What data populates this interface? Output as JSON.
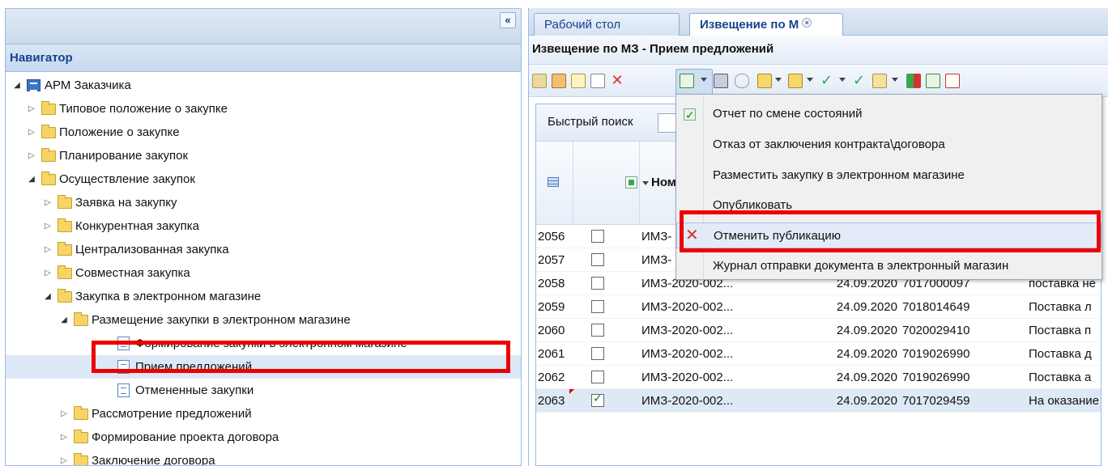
{
  "navigator": {
    "collapse_glyph": "«",
    "header": "Навигатор",
    "tree": [
      {
        "label": "АРМ Заказчика",
        "level": 0,
        "state": "expanded",
        "icon": "workstation-icon"
      },
      {
        "label": "Типовое положение о закупке",
        "level": 1,
        "state": "collapsed",
        "icon": "folder-icon"
      },
      {
        "label": "Положение о закупке",
        "level": 1,
        "state": "collapsed",
        "icon": "folder-icon"
      },
      {
        "label": "Планирование закупок",
        "level": 1,
        "state": "collapsed",
        "icon": "folder-icon"
      },
      {
        "label": "Осуществление закупок",
        "level": 1,
        "state": "expanded",
        "icon": "folder-icon"
      },
      {
        "label": "Заявка на закупку",
        "level": 2,
        "state": "collapsed",
        "icon": "folder-icon"
      },
      {
        "label": "Конкурентная закупка",
        "level": 2,
        "state": "collapsed",
        "icon": "folder-icon"
      },
      {
        "label": "Централизованная закупка",
        "level": 2,
        "state": "collapsed",
        "icon": "folder-icon"
      },
      {
        "label": "Совместная закупка",
        "level": 2,
        "state": "collapsed",
        "icon": "folder-icon"
      },
      {
        "label": "Закупка в электронном магазине",
        "level": 2,
        "state": "expanded",
        "icon": "folder-icon"
      },
      {
        "label": "Размещение закупки в электронном магазине",
        "level": 3,
        "state": "expanded",
        "icon": "folder-icon"
      },
      {
        "label": "Формирование закупки в электронном магазине",
        "level": 4,
        "state": "leaf",
        "icon": "document-icon"
      },
      {
        "label": "Прием предложений",
        "level": 4,
        "state": "leaf",
        "icon": "document-icon",
        "selected": true
      },
      {
        "label": "Отмененные закупки",
        "level": 4,
        "state": "leaf",
        "icon": "document-icon"
      },
      {
        "label": "Рассмотрение предложений",
        "level": 3,
        "state": "collapsed",
        "icon": "folder-icon"
      },
      {
        "label": "Формирование проекта договора",
        "level": 3,
        "state": "collapsed",
        "icon": "folder-icon"
      },
      {
        "label": "Заключение договора",
        "level": 3,
        "state": "collapsed",
        "icon": "folder-icon"
      }
    ]
  },
  "tabs": [
    {
      "label": "Рабочий стол",
      "active": false
    },
    {
      "label": "Извещение по М",
      "active": true,
      "close_glyph": "×"
    }
  ],
  "document": {
    "title": "Извещение по МЗ - Прием предложений"
  },
  "search": {
    "label": "Быстрый поиск",
    "value": ""
  },
  "grid": {
    "header_number": "Номе",
    "rows": [
      {
        "id": "2056",
        "checked": false,
        "number": "ИМЗ-",
        "date": "",
        "inn": "",
        "subject": ""
      },
      {
        "id": "2057",
        "checked": false,
        "number": "ИМЗ-",
        "date": "",
        "inn": "",
        "subject": ""
      },
      {
        "id": "2058",
        "checked": false,
        "number": "ИМЗ-2020-002...",
        "date": "24.09.2020",
        "inn": "7017000097",
        "subject": "поставка не"
      },
      {
        "id": "2059",
        "checked": false,
        "number": "ИМЗ-2020-002...",
        "date": "24.09.2020",
        "inn": "7018014649",
        "subject": "Поставка л"
      },
      {
        "id": "2060",
        "checked": false,
        "number": "ИМЗ-2020-002...",
        "date": "24.09.2020",
        "inn": "7020029410",
        "subject": "Поставка п"
      },
      {
        "id": "2061",
        "checked": false,
        "number": "ИМЗ-2020-002...",
        "date": "24.09.2020",
        "inn": "7019026990",
        "subject": "Поставка д"
      },
      {
        "id": "2062",
        "checked": false,
        "number": "ИМЗ-2020-002...",
        "date": "24.09.2020",
        "inn": "7019026990",
        "subject": "Поставка а"
      },
      {
        "id": "2063",
        "checked": true,
        "number": "ИМЗ-2020-002...",
        "date": "24.09.2020",
        "inn": "7017029459",
        "subject": "На оказание",
        "selected": true
      }
    ]
  },
  "menu": {
    "items": [
      {
        "label": "Отчет по смене состояний",
        "icon": "check-report-icon"
      },
      {
        "label": "Отказ от заключения контракта\\договора",
        "icon": ""
      },
      {
        "label": "Разместить закупку в электронном магазине",
        "icon": ""
      },
      {
        "label": "Опубликовать",
        "icon": ""
      },
      {
        "label": "Отменить публикацию",
        "icon": "cancel-x-icon",
        "hover": true
      },
      {
        "label": "Журнал отправки документа в электронный магазин",
        "icon": ""
      }
    ]
  },
  "colors": {
    "highlight": "#ee0000",
    "panel_border": "#99bbe8",
    "header_text": "#15428b"
  }
}
